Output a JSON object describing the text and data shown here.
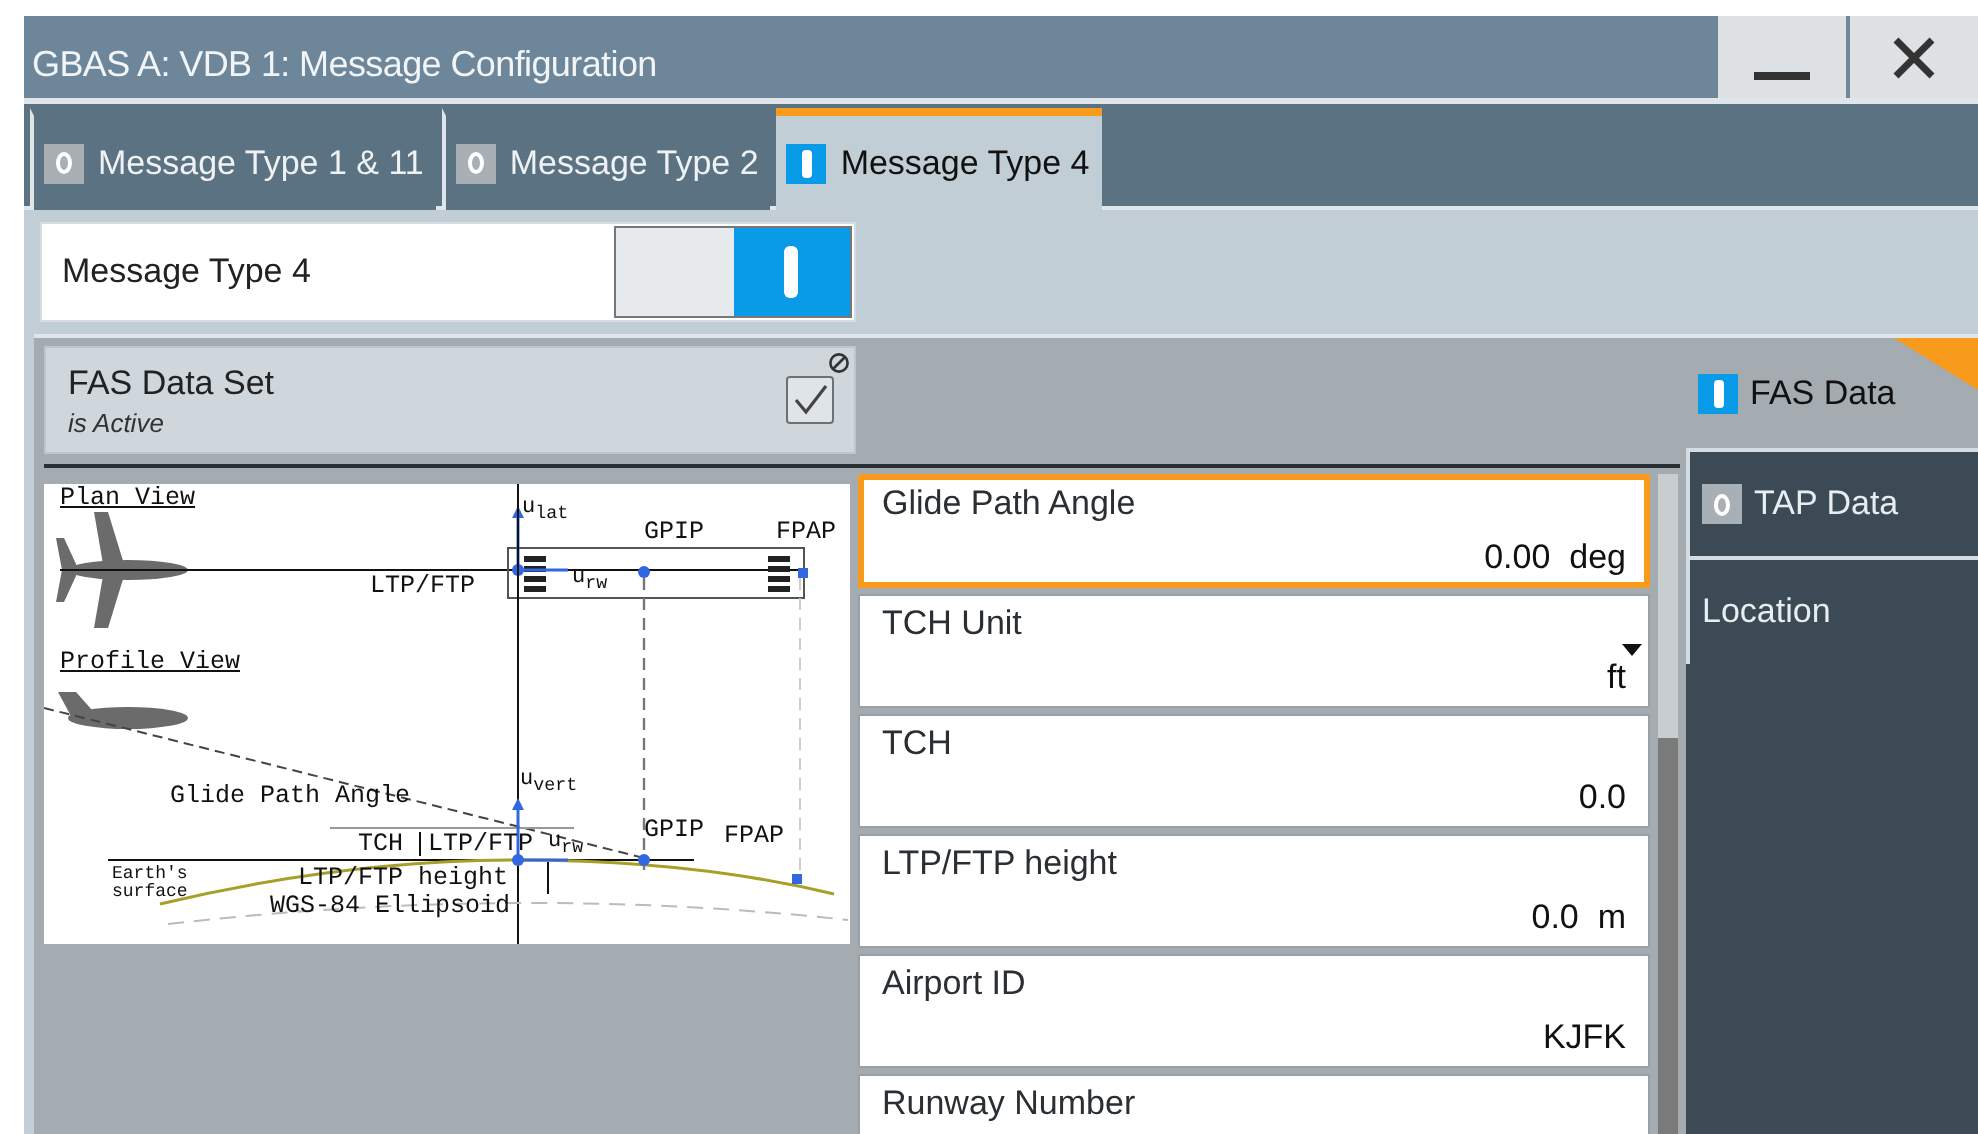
{
  "window": {
    "title": "GBAS A: VDB 1: Message Configuration"
  },
  "tabs": [
    {
      "label": "Message Type 1 & 11",
      "selected": false,
      "on": false
    },
    {
      "label": "Message Type 2",
      "selected": false,
      "on": false
    },
    {
      "label": "Message Type 4",
      "selected": true,
      "on": true
    }
  ],
  "message_switch": {
    "label": "Message Type 4",
    "on": true
  },
  "fas_data_set": {
    "label": "FAS Data Set",
    "status": "is Active",
    "checked": true
  },
  "diagram": {
    "labels": [
      {
        "text": "Plan View",
        "kind": "heading"
      },
      {
        "text": "u$_{lat}$",
        "kind": "axis"
      },
      {
        "text": "LTP/FTP",
        "kind": "point"
      },
      {
        "text": "u$_{rw}$",
        "kind": "axis"
      },
      {
        "text": "GPIP",
        "kind": "point"
      },
      {
        "text": "FPAP",
        "kind": "point"
      },
      {
        "text": "Profile View",
        "kind": "heading"
      },
      {
        "text": "u$_{vert}$",
        "kind": "axis"
      },
      {
        "text": "Glide Path Angle",
        "kind": "point"
      },
      {
        "text": "TCH",
        "kind": "point"
      },
      {
        "text": "LTP/FTP",
        "kind": "point"
      },
      {
        "text": "u$_{rw}$",
        "kind": "axis"
      },
      {
        "text": "GPIP",
        "kind": "point"
      },
      {
        "text": "FPAP",
        "kind": "point"
      },
      {
        "text": "Earth's surface",
        "kind": "note"
      },
      {
        "text": "LTP/FTP height",
        "kind": "point"
      },
      {
        "text": "WGS-84 Ellipsoid",
        "kind": "point"
      }
    ]
  },
  "fields": [
    {
      "label": "Glide Path Angle",
      "value": "0.00",
      "unit": "deg",
      "kind": "number",
      "selected": true
    },
    {
      "label": "TCH Unit",
      "value": "ft",
      "kind": "dropdown",
      "selected": false
    },
    {
      "label": "TCH",
      "value": "0.0",
      "kind": "number",
      "selected": false
    },
    {
      "label": "LTP/FTP height",
      "value": "0.0",
      "unit": "m",
      "kind": "number",
      "selected": false
    },
    {
      "label": "Airport ID",
      "value": "KJFK",
      "kind": "text",
      "selected": false
    },
    {
      "label": "Runway Number",
      "kind": "number",
      "selected": false
    }
  ],
  "side_tabs": [
    {
      "label": "FAS Data",
      "selected": true,
      "kind": "toggle",
      "on": true
    },
    {
      "label": "TAP Data",
      "selected": false,
      "kind": "toggle",
      "on": false
    },
    {
      "label": "Location",
      "selected": false,
      "kind": "plain"
    }
  ]
}
